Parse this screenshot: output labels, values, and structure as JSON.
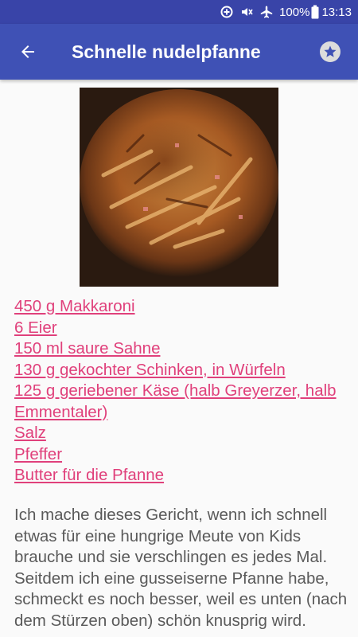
{
  "status_bar": {
    "battery": "100%",
    "time": "13:13",
    "icons": [
      "data-saver-icon",
      "mute-icon",
      "airplane-icon",
      "battery-icon"
    ]
  },
  "app_bar": {
    "back_icon": "arrow-back-icon",
    "title": "Schnelle nudelpfanne",
    "favorite_icon": "star-icon"
  },
  "ingredients": [
    "450 g Makkaroni",
    "6 Eier",
    "150 ml saure Sahne",
    "130 g gekochter Schinken, in Würfeln",
    "125 g geriebener Käse (halb Greyerzer, halb Emmentaler)",
    "Salz",
    "Pfeffer",
    "Butter für die Pfanne"
  ],
  "description": "Ich mache dieses Gericht, wenn ich schnell etwas für eine hungrige Meute von Kids brauche und sie verschlingen es jedes Mal. Seitdem ich eine gusseiserne Pfanne habe, schmeckt es noch besser, weil es unten (nach dem Stürzen oben) schön knusprig wird.",
  "colors": {
    "status_bar": "#3944a8",
    "app_bar": "#3f51b5",
    "link": "#e0407b",
    "body_text": "#5a5a5a",
    "background": "#fafafa"
  }
}
